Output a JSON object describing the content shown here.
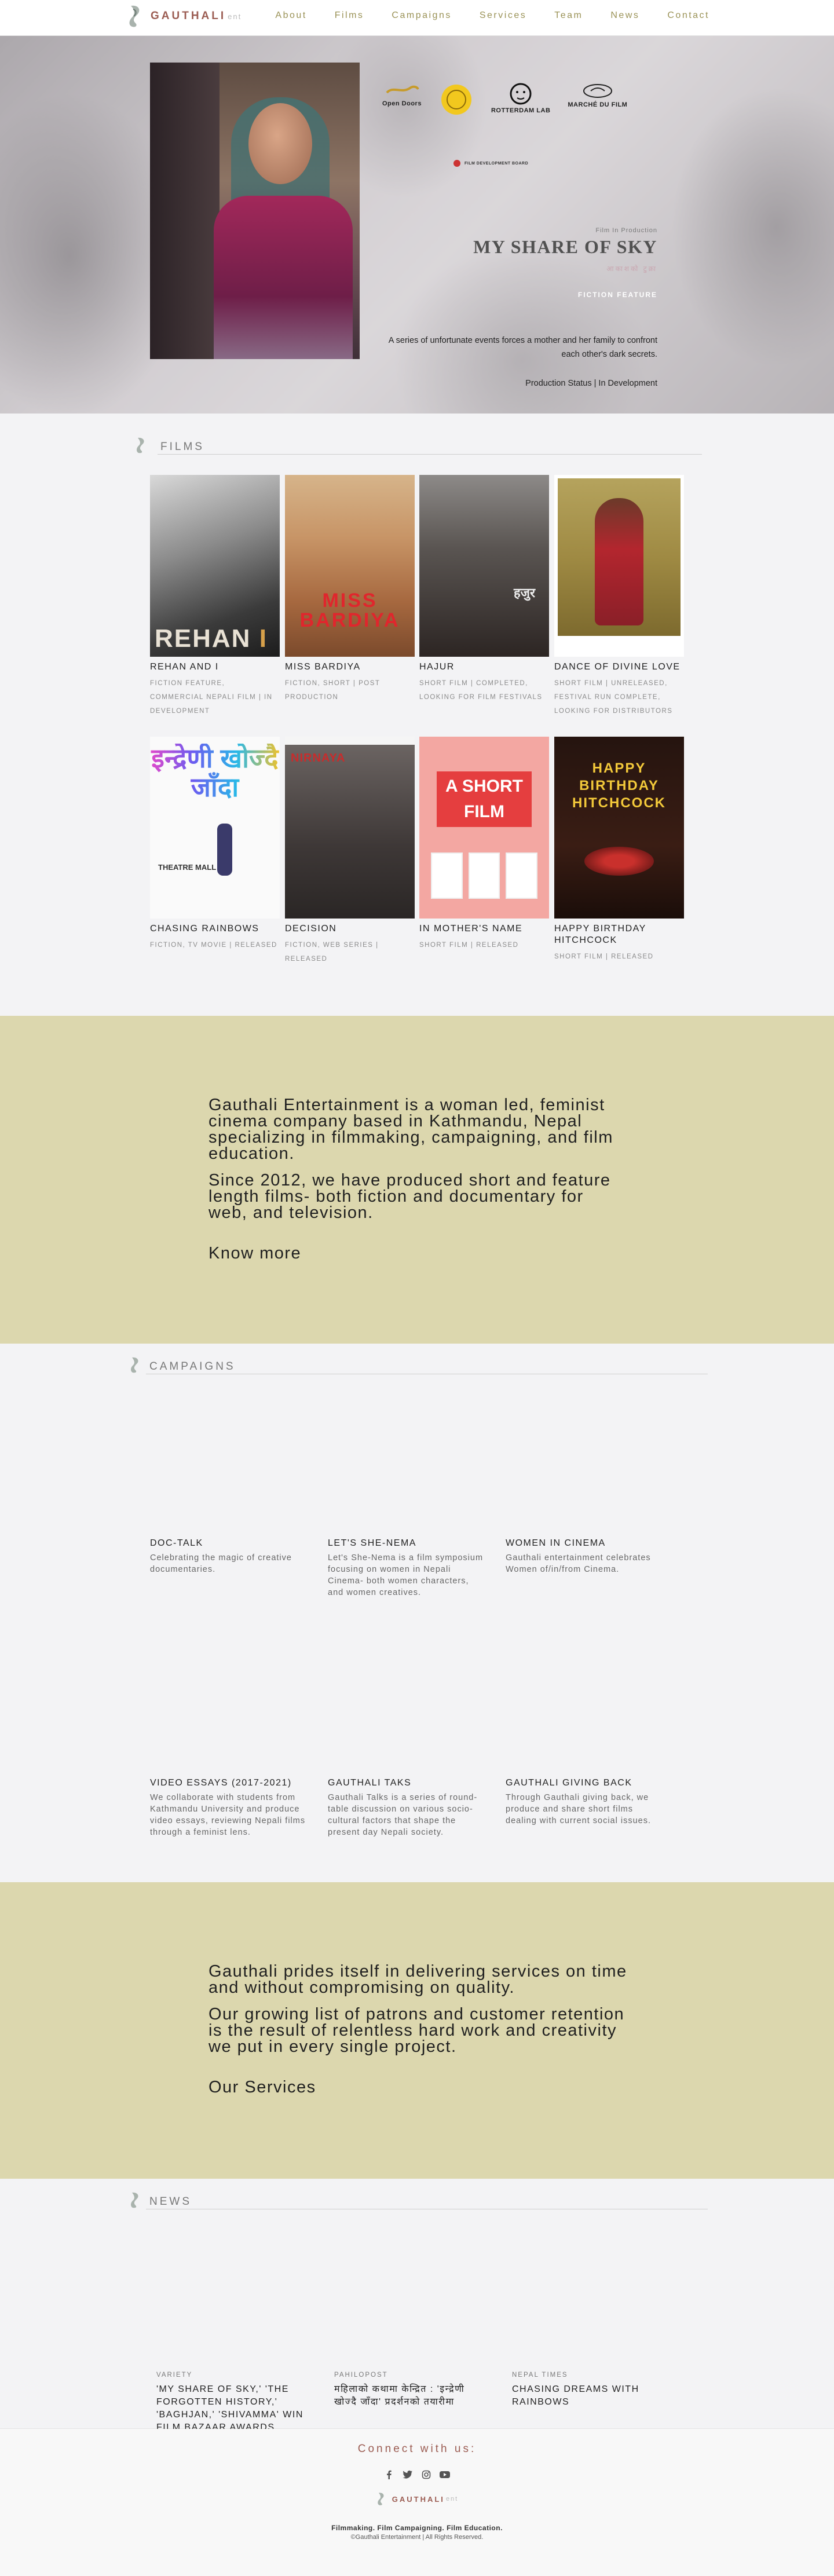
{
  "header": {
    "logo_text": "GAUTHALI",
    "logo_suffix": "ent",
    "nav": [
      "About",
      "Films",
      "Campaigns",
      "Services",
      "Team",
      "News",
      "Contact"
    ]
  },
  "hero": {
    "logos": [
      "Open Doors",
      "ROTTERDAM LAB",
      "MARCHÉ DU FILM"
    ],
    "logos_sub": "FILM DEVELOPMENT BOARD",
    "kicker": "Film In Production",
    "title": "MY SHARE OF SKY",
    "title_sub": "आकाशको टुक्रा",
    "type": "FICTION FEATURE",
    "description": "A series of unfortunate events forces a mother and her family to confront each other's dark secrets.",
    "status": "Production Status | In Development"
  },
  "films": {
    "title": "FILMS",
    "items": [
      {
        "title": "REHAN AND I",
        "meta": "FICTION FEATURE, COMMERCIAL NEPALI FILM | IN DEVELOPMENT",
        "poster": "REHAN I"
      },
      {
        "title": "MISS BARDIYA",
        "meta": "FICTION, SHORT | POST PRODUCTION",
        "poster": "MISS BARDIYA"
      },
      {
        "title": "HAJUR",
        "meta": "SHORT FILM | COMPLETED, LOOKING FOR FILM FESTIVALS",
        "poster": "हजुर"
      },
      {
        "title": "DANCE OF DIVINE LOVE",
        "meta": "SHORT FILM | UNRELEASED, FESTIVAL RUN COMPLETE, LOOKING FOR DISTRIBUTORS",
        "poster": ""
      },
      {
        "title": "CHASING RAINBOWS",
        "meta": "FICTION, TV MOVIE | RELEASED",
        "poster": "इन्द्रेणी खोज्दै जाँदा",
        "poster_sub": "THEATRE MALL"
      },
      {
        "title": "DECISION",
        "meta": "FICTION, WEB SERIES | RELEASED",
        "poster": "NIRNAYA"
      },
      {
        "title": "IN MOTHER'S NAME",
        "meta": "SHORT FILM | RELEASED",
        "poster": "A SHORT FILM"
      },
      {
        "title": "HAPPY BIRTHDAY HITCHCOCK",
        "meta": "SHORT FILM | RELEASED",
        "poster": "HAPPY BIRTHDAY HITCHCOCK"
      }
    ]
  },
  "about": {
    "p1": "Gauthali Entertainment is a woman led, feminist cinema company based in Kathmandu, Nepal specializing in filmmaking, campaigning, and film education.",
    "p2": "Since 2012, we have produced short and feature length films- both fiction and documentary for web, and television.",
    "link": "Know more"
  },
  "campaigns": {
    "title": "CAMPAIGNS",
    "items": [
      {
        "title": "DOC-TALK",
        "desc": "Celebrating the magic of creative documentaries."
      },
      {
        "title": "LET'S SHE-NEMA",
        "desc": "Let's She-Nema is a film symposium focusing on women in Nepali Cinema- both women characters, and women creatives."
      },
      {
        "title": "WOMEN IN CINEMA",
        "desc": "Gauthali entertainment celebrates Women of/in/from Cinema."
      },
      {
        "title": "VIDEO ESSAYS (2017-2021)",
        "desc": "We collaborate with students from Kathmandu University and produce video essays, reviewing Nepali films through a feminist lens."
      },
      {
        "title": "GAUTHALI TAKS",
        "desc": "Gauthali Talks is a series of round-table discussion on various socio-cultural factors that shape the present day Nepali society."
      },
      {
        "title": "GAUTHALI GIVING BACK",
        "desc": "Through Gauthali giving back, we produce and share short films dealing with current social issues."
      }
    ]
  },
  "services": {
    "p1": "Gauthali prides itself in delivering services on time and without compromising on quality.",
    "p2": "Our growing list of patrons and customer retention is the result of relentless hard work and creativity we put in every single project.",
    "link": "Our Services"
  },
  "news": {
    "title": "NEWS",
    "items": [
      {
        "source": "VARIETY",
        "title": "'MY SHARE OF SKY,' 'THE FORGOTTEN HISTORY,' 'BAGHJAN,' 'SHIVAMMA' WIN FILM BAZAAR AWARDS"
      },
      {
        "source": "PAHILOPOST",
        "title": "महिलाको कथामा केन्द्रित : 'इन्द्रेणी खोज्दै जाँदा' प्रदर्शनको तयारीमा"
      },
      {
        "source": "NEPAL TIMES",
        "title": "CHASING DREAMS WITH RAINBOWS"
      }
    ]
  },
  "footer": {
    "connect": "Connect with us:",
    "socials": [
      "facebook-icon",
      "twitter-icon",
      "instagram-icon",
      "youtube-icon"
    ],
    "logo_text": "GAUTHALI",
    "logo_suffix": "ent",
    "tagline": "Filmmaking. Film Campaigning. Film Education.",
    "copyright": "©Gauthali Entertainment | All Rights Reserved."
  },
  "colors": {
    "accent_olive": "#9a9256",
    "brand_rose": "#9b5c52",
    "section_band": "#dcd7ae"
  }
}
